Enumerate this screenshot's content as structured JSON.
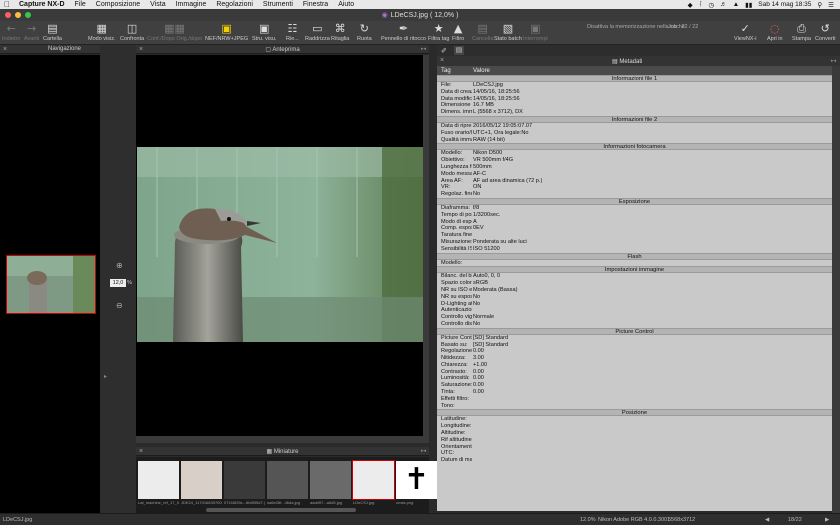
{
  "menubar": {
    "app": "Capture NX-D",
    "items": [
      "File",
      "Composizione",
      "Vista",
      "Immagine",
      "Regolazioni",
      "Strumenti",
      "Finestra",
      "Aiuto"
    ],
    "datetime": "Sab 14 mag  18:35"
  },
  "window": {
    "title": "LDeCSJ.jpg ( 12,0% )"
  },
  "toolbar": {
    "back": "Indietro",
    "forward": "Avanti",
    "folder": "Cartella",
    "view_mode": "Modo visiz.",
    "compare": "Confronta",
    "compare_sub": "Conf./Dopo  Orig./dopo",
    "nef_jpeg": "NEF/NRW+JPEG",
    "tools": "Stru. visu.",
    "fill": "Rie...",
    "straighten": "Raddrizza",
    "crop": "Ritaglia",
    "rotate": "Ruota",
    "retouch": "Pennello di ritocco",
    "filter_tag": "Filtra tag",
    "filter": "Filtro",
    "delete": "Cancella",
    "batch_status": "Stato batch",
    "interrupt": "Interrompi",
    "batch_info": "Disattiva la memorizzazione nella cache",
    "jobs_label": "Job :",
    "jobs_value": "22 / 22",
    "viewnx": "ViewNX-i",
    "open_in": "Apri in",
    "print": "Stampa",
    "convert": "Converti"
  },
  "navigation": {
    "title": "Navigazione",
    "zoom": "12,0",
    "zoom_unit": "%"
  },
  "preview": {
    "title": "Anteprima"
  },
  "thumbnails": {
    "title": "Miniature",
    "items": [
      {
        "label": "Lat_machine_ref_17_01...",
        "color": "#ececec"
      },
      {
        "label": "JDE24_1170168357000...",
        "color": "#d8d0c8"
      },
      {
        "label": "071f4839c...6b8f35d7.jpg",
        "color": "#3a3a3a"
      },
      {
        "label": "sa6e08f...46da.jpg",
        "color": "#555"
      },
      {
        "label": "aadd97...a6d5.jpg",
        "color": "#6a6a6a"
      },
      {
        "label": "LDeCSJ.jpg",
        "color": "#ececec"
      },
      {
        "label": "cross.png",
        "color": "#ffffff"
      }
    ]
  },
  "metadata": {
    "title": "Metadati",
    "col_tag": "Tag",
    "col_value": "Valore",
    "sections": [
      {
        "title": "Informazioni file 1",
        "rows": [
          [
            "File:",
            "LDeCSJ.jpg"
          ],
          [
            "Data di creaz",
            "14/05/16, 18:25:56"
          ],
          [
            "Data modific",
            "14/05/16, 18:25:56"
          ],
          [
            "Dimensione f",
            "16.7 MB"
          ],
          [
            "Dimens. imm",
            "L (5568 x 3712), DX"
          ]
        ]
      },
      {
        "title": "Informazioni file 2",
        "rows": [
          [
            "Data di ripre",
            "2016/05/12 19:05:07.07"
          ],
          [
            "Fuso orario/l",
            "UTC+1, Ora legale:No"
          ],
          [
            "Qualità imma",
            "RAW (14 bit)"
          ]
        ]
      },
      {
        "title": "Informazioni fotocamera",
        "rows": [
          [
            "Modello:",
            "Nikon D500"
          ],
          [
            "Obiettivo:",
            "VR 500mm f/4G"
          ],
          [
            "Lunghezza fo",
            "500mm"
          ],
          [
            "Modo messa",
            "AF-C"
          ],
          [
            "Area AF:",
            "AF ad area dinamica (72 p.)"
          ],
          [
            "VR:",
            "ON"
          ],
          [
            "Regolaz. fine",
            "No"
          ]
        ]
      },
      {
        "title": "Esposizione",
        "rows": [
          [
            "Diaframma:",
            "f/8"
          ],
          [
            "Tempo di pos",
            "1/3200sec."
          ],
          [
            "Modo di espo",
            "A"
          ],
          [
            "Comp. espos",
            "0EV"
          ],
          [
            "Taratura fine",
            ""
          ],
          [
            "Misurazione:",
            "Ponderata su alte luci"
          ],
          [
            "Sensibilità ISO",
            "ISO 51200"
          ]
        ]
      },
      {
        "title": "Flash",
        "rows": [
          [
            "Modello:",
            ""
          ]
        ]
      },
      {
        "title": "Impostazioni immagine",
        "rows": [
          [
            "Bilanc. del bi",
            "Auto0, 0, 0"
          ],
          [
            "Spazio colore",
            "sRGB"
          ],
          [
            "NR su ISO el",
            "Moderata (Bassa)"
          ],
          [
            "NR su esposi",
            "No"
          ],
          [
            "D-Lighting at",
            "No"
          ],
          [
            "Autenticazior",
            ""
          ],
          [
            "Controllo vig",
            "Normale"
          ],
          [
            "Controllo dist",
            "No"
          ]
        ]
      },
      {
        "title": "Picture Control",
        "rows": [
          [
            "Picture Contr",
            "[SD] Standard"
          ],
          [
            "Basato su:",
            "[SD] Standard"
          ],
          [
            "Regolazione r",
            "0.00"
          ],
          [
            "Nitidezza:",
            "3.00"
          ],
          [
            "Chiarezza:",
            "+1.00"
          ],
          [
            "Contrasto:",
            "0.00"
          ],
          [
            "Luminosità:",
            "0.00"
          ],
          [
            "Saturazione:",
            "0.00"
          ],
          [
            "Tinta:",
            "0.00"
          ],
          [
            "Effetti filtro:",
            ""
          ],
          [
            "Tono:",
            ""
          ]
        ]
      },
      {
        "title": "Posizione",
        "rows": [
          [
            "Latitudine:",
            ""
          ],
          [
            "Longitudine:",
            ""
          ],
          [
            "Altitudine:",
            ""
          ],
          [
            "Rif altitudine:",
            ""
          ],
          [
            "Orientamento",
            ""
          ],
          [
            "UTC:",
            ""
          ],
          [
            "Datum di map",
            ""
          ]
        ]
      }
    ]
  },
  "status": {
    "filename": "LDeCSJ.jpg",
    "zoom": "12.0%",
    "profile": "Nikon Adobe RGB 4.0.0.3001",
    "size": "5568x3712",
    "counter": "18/22"
  }
}
